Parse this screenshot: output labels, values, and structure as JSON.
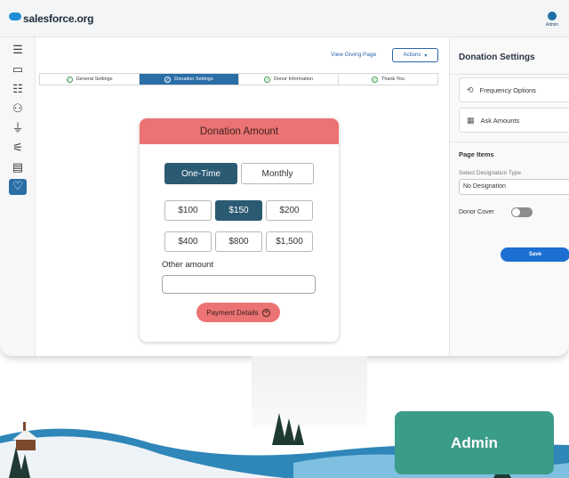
{
  "header": {
    "logo_text": "salesforce.org",
    "admin_label": "Admin"
  },
  "toolbar": {
    "view_giving_page": "View Giving Page",
    "actions_label": "Actions"
  },
  "steps": [
    {
      "label": "General Settings",
      "active": false
    },
    {
      "label": "Donation Settings",
      "active": true
    },
    {
      "label": "Donor Information",
      "active": false
    },
    {
      "label": "Thank You",
      "active": false
    }
  ],
  "donation_card": {
    "title": "Donation Amount",
    "frequency": {
      "selected": "One-Time",
      "other": "Monthly"
    },
    "amounts": [
      "$100",
      "$150",
      "$200",
      "$400",
      "$800",
      "$1,500"
    ],
    "selected_amount": "$150",
    "other_amount_label": "Other amount",
    "other_amount_value": "",
    "payment_button": "Payment Details"
  },
  "right_panel": {
    "title": "Donation Settings",
    "items": [
      "Frequency Options",
      "Ask Amounts"
    ],
    "page_items_heading": "Page Items",
    "designation_label": "Select Designation Type",
    "designation_value": "No Designation",
    "donor_cover_label": "Donor Cover",
    "donor_cover_on": false,
    "save_label": "Save"
  },
  "badge": {
    "label": "Admin"
  },
  "colors": {
    "accent": "#2a6ea6",
    "coral": "#ec7373",
    "teal": "#3c9c8a",
    "save": "#1d6fd1"
  }
}
